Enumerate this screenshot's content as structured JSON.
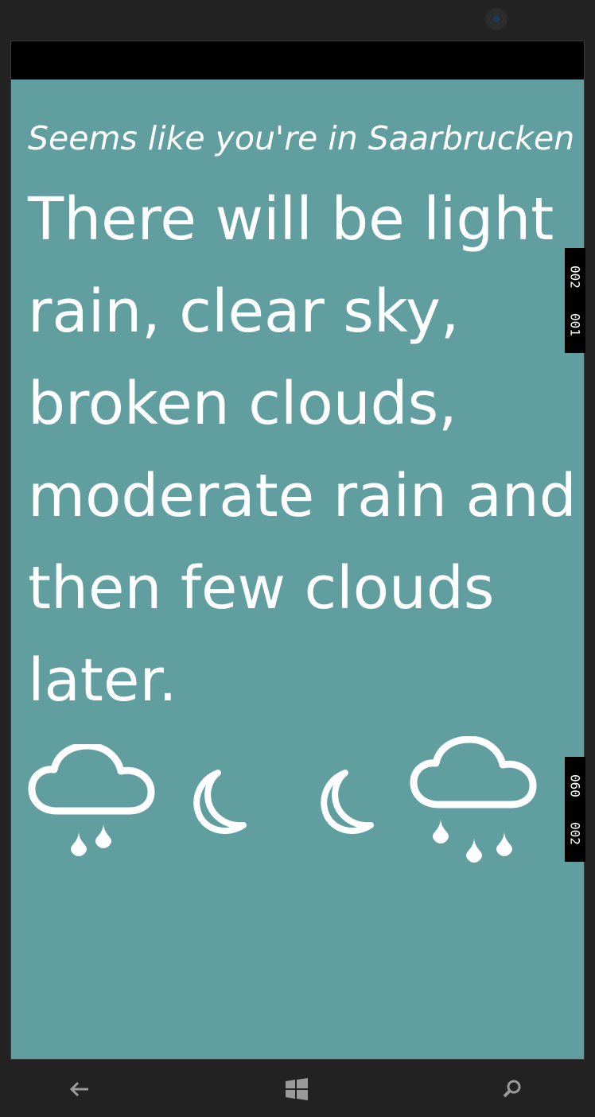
{
  "app": {
    "location_text": "Seems like you're in Saarbrucken",
    "forecast_text": "There will be light rain, clear sky, broken clouds, moderate rain and then few clouds later."
  },
  "weather_icons": [
    {
      "name": "cloud-rain-icon"
    },
    {
      "name": "moon-icon"
    },
    {
      "name": "moon-icon"
    },
    {
      "name": "cloud-heavy-rain-icon"
    }
  ],
  "debug_tags": [
    {
      "a": "002",
      "b": "001"
    },
    {
      "a": "060",
      "b": "002"
    }
  ],
  "colors": {
    "app_background": "#609ea0",
    "text": "#ffffff",
    "chrome": "#222222"
  },
  "nav": {
    "back_icon": "back-arrow-icon",
    "home_icon": "windows-logo-icon",
    "search_icon": "search-icon"
  }
}
